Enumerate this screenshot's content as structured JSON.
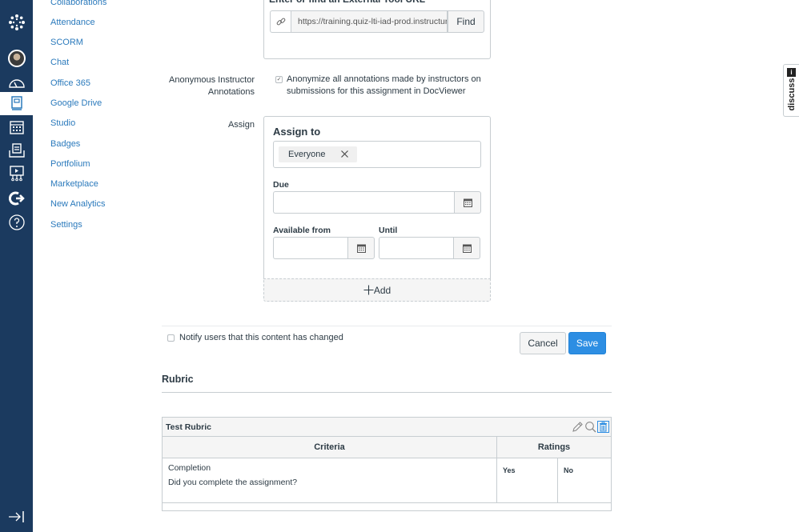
{
  "global_nav": {
    "items": [
      {
        "name": "logo",
        "icon": "canvas-logo-icon"
      },
      {
        "name": "account",
        "icon": "avatar"
      },
      {
        "name": "dashboard",
        "icon": "dashboard-icon"
      },
      {
        "name": "courses",
        "icon": "courses-icon",
        "active": true
      },
      {
        "name": "calendar",
        "icon": "calendar-icon"
      },
      {
        "name": "inbox",
        "icon": "inbox-icon"
      },
      {
        "name": "studio",
        "icon": "studio-icon"
      },
      {
        "name": "commons",
        "icon": "commons-icon"
      },
      {
        "name": "help",
        "icon": "help-icon"
      }
    ],
    "collapse_icon": "collapse-nav-icon"
  },
  "course_nav": {
    "items": [
      "Collaborations",
      "Attendance",
      "SCORM",
      "Chat",
      "Office 365",
      "Google Drive",
      "Studio",
      "Badges",
      "Portfolium",
      "Marketplace",
      "New Analytics",
      "Settings"
    ]
  },
  "external_tool": {
    "title": "Enter or find an External Tool URL",
    "url_value": "https://training.quiz-lti-iad-prod.instructure.com/lti/launch",
    "find_label": "Find"
  },
  "anonymous": {
    "label": "Anonymous Instructor Annotations",
    "label_line1": "Anonymous Instructor",
    "label_line2": "Annotations",
    "checked": true,
    "text_line1": "Anonymize all annotations made by instructors on",
    "text_line2": "submissions for this assignment in DocViewer"
  },
  "assign": {
    "label": "Assign",
    "title": "Assign to",
    "token": "Everyone",
    "due_label": "Due",
    "available_from_label": "Available from",
    "until_label": "Until",
    "add_label": "Add"
  },
  "footer": {
    "notify_label": "Notify users that this content has changed",
    "notify_checked": false,
    "cancel_label": "Cancel",
    "save_label": "Save"
  },
  "rubric": {
    "heading": "Rubric",
    "title": "Test Rubric",
    "criteria_header": "Criteria",
    "ratings_header": "Ratings",
    "criteria": [
      {
        "title": "Completion",
        "description": "Did you complete the assignment?",
        "ratings": [
          "Yes",
          "No"
        ]
      }
    ]
  },
  "discuss_tab": {
    "label": "discuss",
    "badge": "i"
  },
  "colors": {
    "nav_bg": "#1b3a5f",
    "link": "#2b7abc",
    "primary": "#2d8ee3"
  }
}
